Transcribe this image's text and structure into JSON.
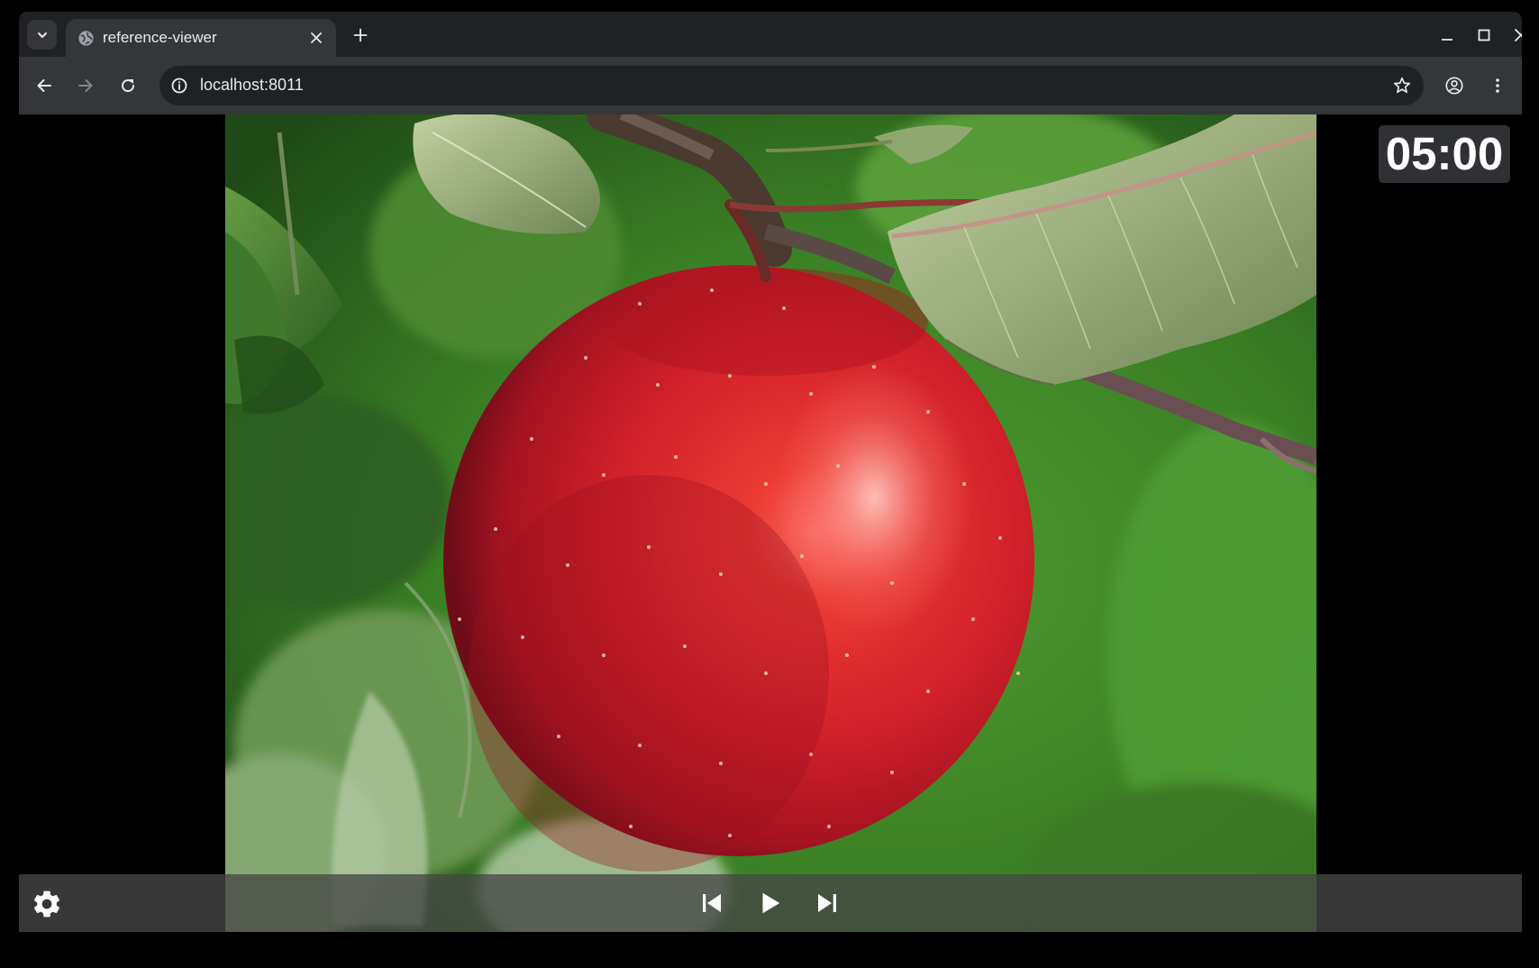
{
  "browser": {
    "tab_title": "reference-viewer",
    "url": "localhost:8011"
  },
  "viewer": {
    "timer": "05:00",
    "image_subject": "red apple on a branch with leaves"
  },
  "icons": {
    "tab_search": "chevron-down-icon",
    "favicon": "globe-icon",
    "tab_close": "close-icon",
    "new_tab": "plus-icon",
    "minimize": "minimize-icon",
    "maximize": "maximize-icon",
    "close_window": "close-icon",
    "back": "arrow-left-icon",
    "forward": "arrow-right-icon",
    "reload": "reload-icon",
    "site_info": "info-icon",
    "bookmark": "star-icon",
    "profile": "account-icon",
    "menu": "more-vert-icon",
    "settings": "gear-icon",
    "previous": "skip-previous-icon",
    "play": "play-icon",
    "next": "skip-next-icon"
  },
  "colors": {
    "tabstrip_bg": "#202124",
    "toolbar_bg": "#35363a",
    "viewport_bg": "#000000",
    "apple_red": "#d8222a",
    "foliage_green": "#3f8a2a"
  }
}
